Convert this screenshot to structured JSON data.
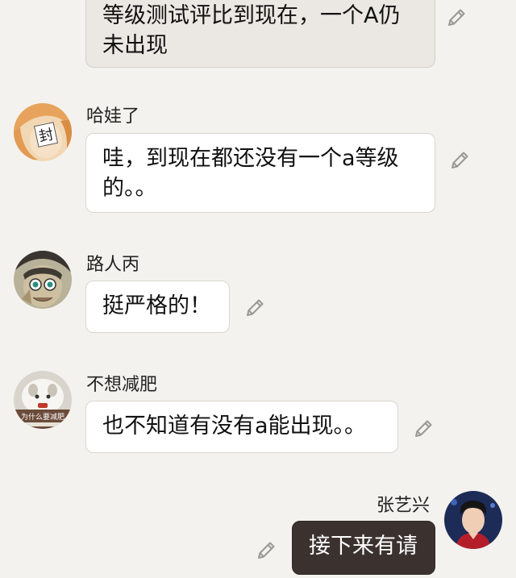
{
  "messages": [
    {
      "id": "top",
      "text": "等级测试评比到现在，一个A仍未出现"
    },
    {
      "id": "hawa",
      "name": "哈娃了",
      "text": "哇，到现在都还没有一个a等级的。。",
      "avatar_label": "封"
    },
    {
      "id": "luren",
      "name": "路人丙",
      "text": "挺严格的！"
    },
    {
      "id": "buxiang",
      "name": "不想减肥",
      "text": "也不知道有没有a能出现。。",
      "avatar_caption": "为什么要减肥"
    },
    {
      "id": "zhang",
      "name": "张艺兴",
      "text": "接下来有请"
    }
  ],
  "icons": {
    "edit": "pencil-icon"
  },
  "colors": {
    "background": "#f4f2ee",
    "bubble_white": "#ffffff",
    "bubble_gray": "#ebe8e3",
    "bubble_dark": "#3b3230",
    "icon": "#9a9894"
  }
}
